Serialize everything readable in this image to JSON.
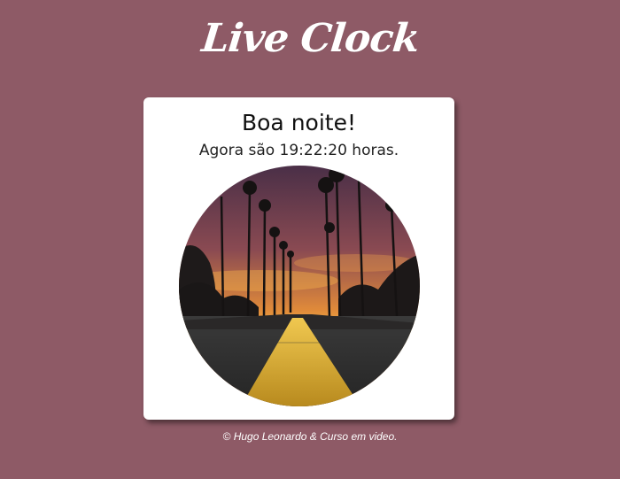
{
  "header": {
    "title": "Live Clock"
  },
  "card": {
    "greeting": "Boa noite!",
    "time_message": "Agora são 19:22:20 horas.",
    "photo_alt": "Estrada ao pôr do sol com palmeiras"
  },
  "footer": {
    "credit": "© Hugo Leonardo & Curso em video."
  },
  "colors": {
    "background": "#8e5a66",
    "card": "#ffffff",
    "road_line": "#e0b830"
  }
}
